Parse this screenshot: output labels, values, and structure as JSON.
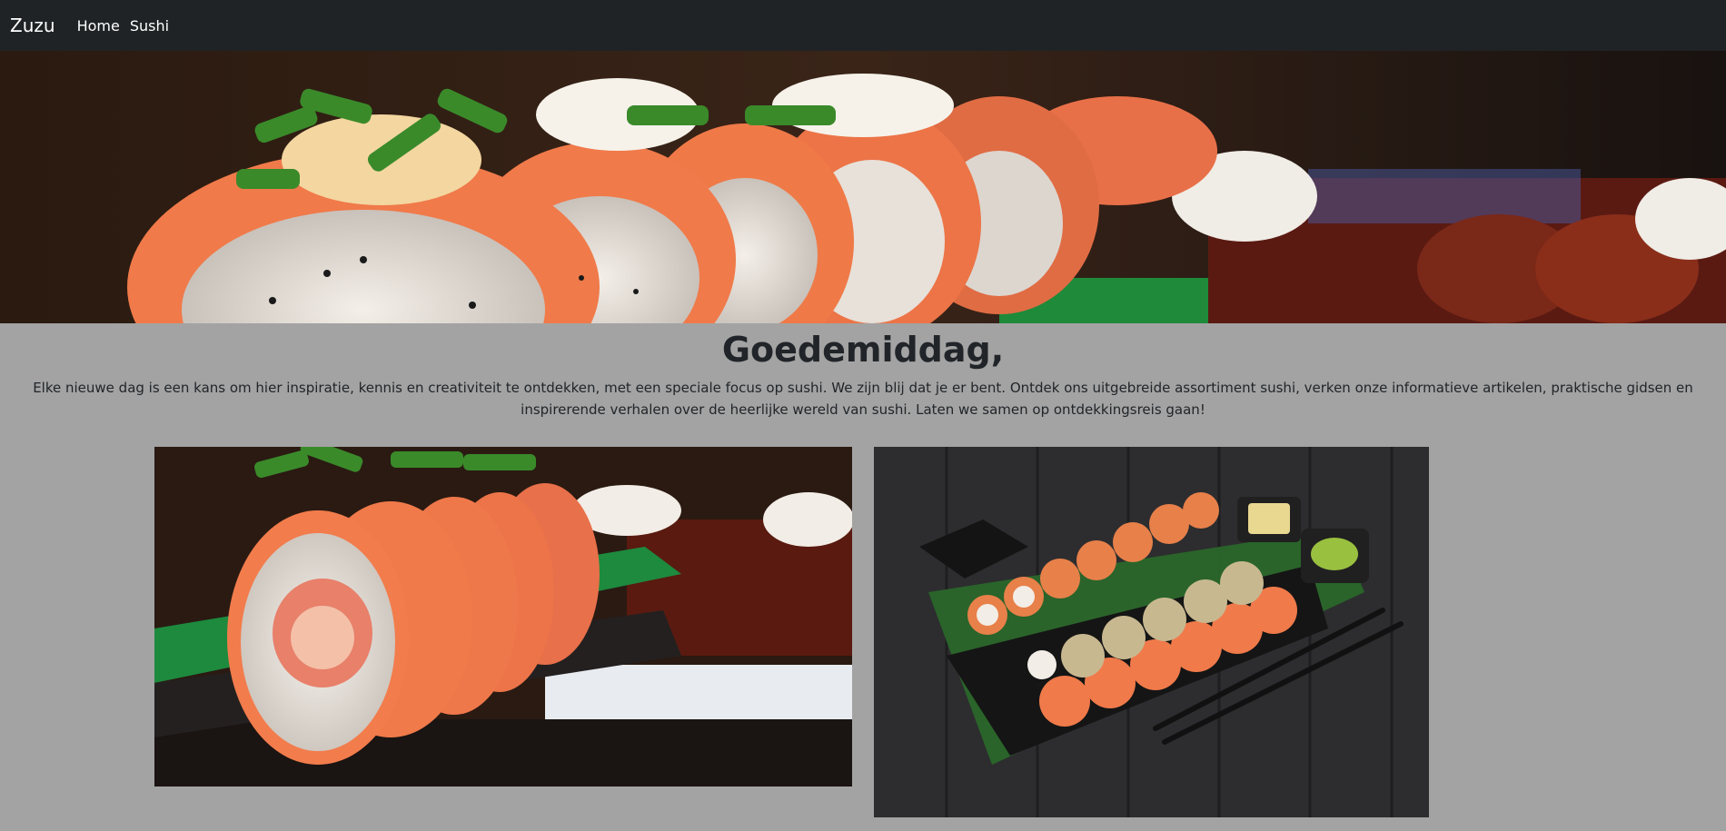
{
  "navbar": {
    "brand": "Zuzu",
    "links": [
      {
        "label": "Home"
      },
      {
        "label": "Sushi"
      }
    ]
  },
  "hero": {
    "image": "salmon-sushi-rolls-banner"
  },
  "main": {
    "greeting": "Goedemiddag,",
    "intro": "Elke nieuwe dag is een kans om hier inspiratie, kennis en creativiteit te ontdekken, met een speciale focus op sushi. We zijn blij dat je er bent. Ontdek ons uitgebreide assortiment sushi, verken onze informatieve artikelen, praktische gidsen en inspirerende verhalen over de heerlijke wereld van sushi. Laten we samen op ontdekkingsreis gaan!"
  },
  "gallery": [
    {
      "image": "salmon-sushi-rolls-closeup"
    },
    {
      "image": "sushi-platter-with-chopsticks"
    }
  ],
  "colors": {
    "navbar_bg": "#1f2326",
    "page_bg": "#a3a3a3",
    "text": "#212529",
    "salmon": "#f07a4a"
  }
}
